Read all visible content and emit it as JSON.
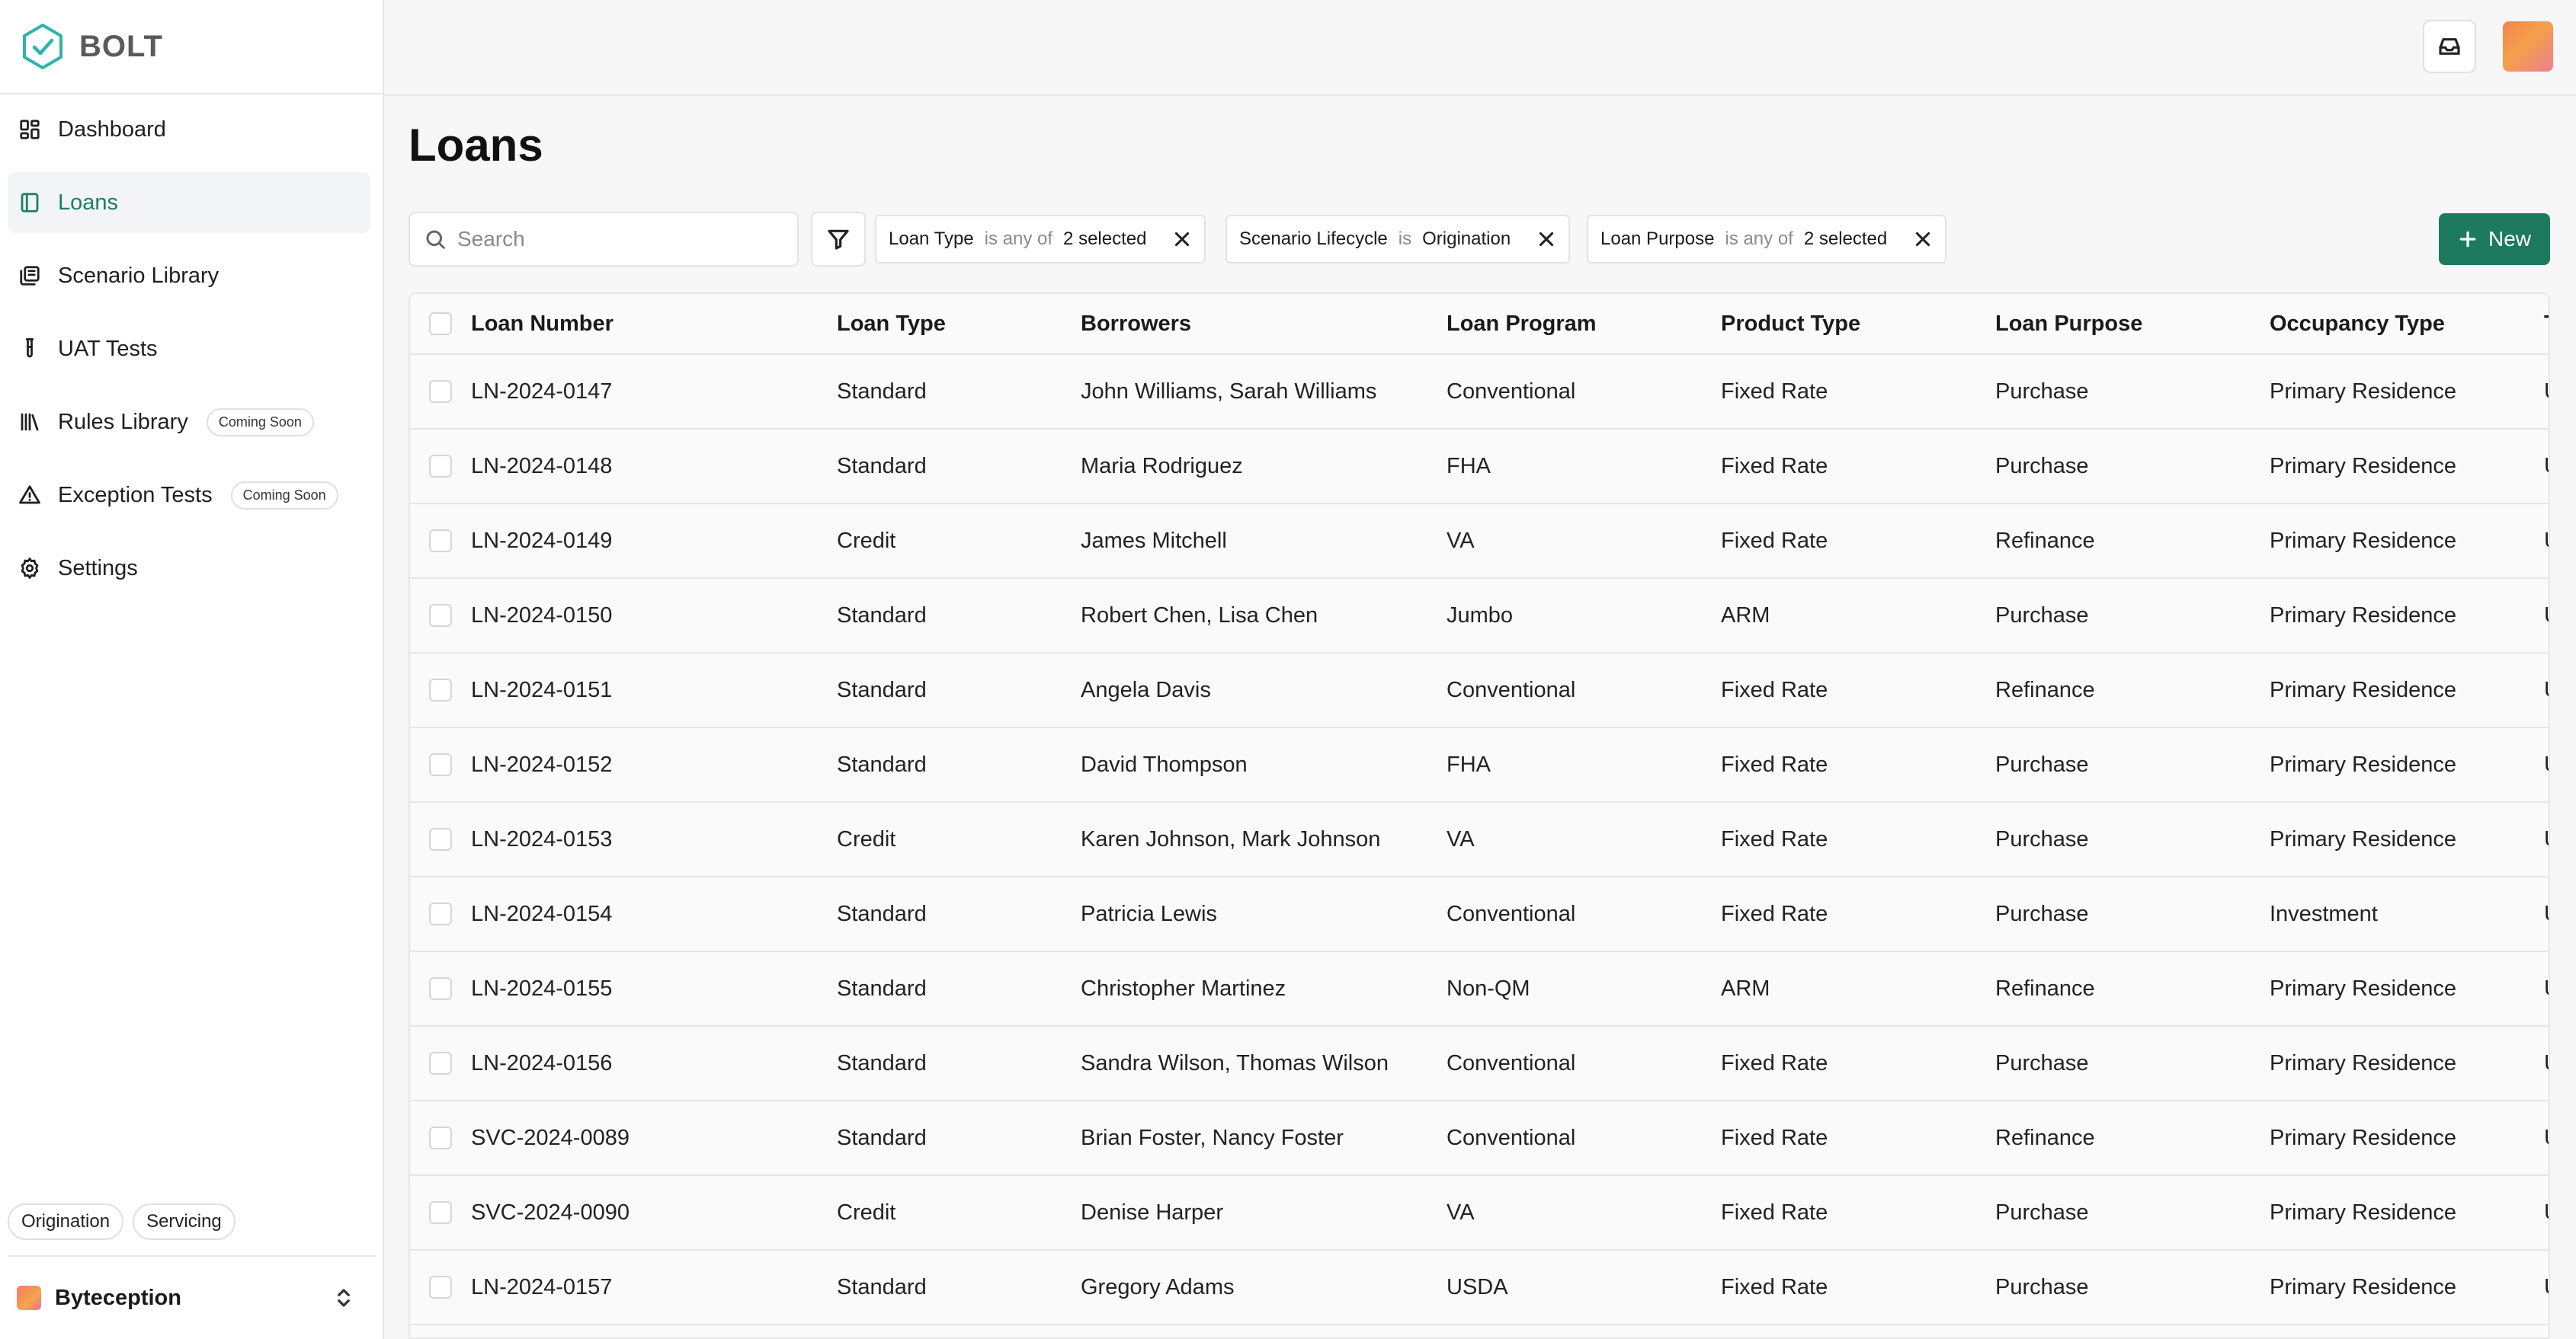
{
  "brand": {
    "name": "BOLT"
  },
  "sidebar": {
    "items": [
      {
        "label": "Dashboard",
        "icon": "dashboard-icon",
        "active": false
      },
      {
        "label": "Loans",
        "icon": "book-icon",
        "active": true
      },
      {
        "label": "Scenario Library",
        "icon": "library-icon",
        "active": false
      },
      {
        "label": "UAT Tests",
        "icon": "test-tube-icon",
        "active": false
      },
      {
        "label": "Rules Library",
        "icon": "books-icon",
        "badge": "Coming Soon",
        "active": false
      },
      {
        "label": "Exception Tests",
        "icon": "warning-icon",
        "badge": "Coming Soon",
        "active": false
      },
      {
        "label": "Settings",
        "icon": "gear-icon",
        "active": false
      }
    ],
    "modes": [
      "Origination",
      "Servicing"
    ],
    "org": {
      "name": "Byteception"
    }
  },
  "page": {
    "title": "Loans"
  },
  "toolbar": {
    "search_placeholder": "Search",
    "filters": [
      {
        "field": "Loan Type",
        "op": "is any of",
        "value": "2 selected"
      },
      {
        "field": "Scenario Lifecycle",
        "op": "is",
        "value": "Origination"
      },
      {
        "field": "Loan Purpose",
        "op": "is any of",
        "value": "2 selected"
      }
    ],
    "new_label": "New"
  },
  "table": {
    "columns": [
      "Loan Number",
      "Loan Type",
      "Borrowers",
      "Loan Program",
      "Product Type",
      "Loan Purpose",
      "Occupancy Type",
      "T"
    ],
    "rows": [
      [
        "LN-2024-0147",
        "Standard",
        "John Williams, Sarah Williams",
        "Conventional",
        "Fixed Rate",
        "Purchase",
        "Primary Residence",
        "U"
      ],
      [
        "LN-2024-0148",
        "Standard",
        "Maria Rodriguez",
        "FHA",
        "Fixed Rate",
        "Purchase",
        "Primary Residence",
        "U"
      ],
      [
        "LN-2024-0149",
        "Credit",
        "James Mitchell",
        "VA",
        "Fixed Rate",
        "Refinance",
        "Primary Residence",
        "U"
      ],
      [
        "LN-2024-0150",
        "Standard",
        "Robert Chen, Lisa Chen",
        "Jumbo",
        "ARM",
        "Purchase",
        "Primary Residence",
        "U"
      ],
      [
        "LN-2024-0151",
        "Standard",
        "Angela Davis",
        "Conventional",
        "Fixed Rate",
        "Refinance",
        "Primary Residence",
        "U"
      ],
      [
        "LN-2024-0152",
        "Standard",
        "David Thompson",
        "FHA",
        "Fixed Rate",
        "Purchase",
        "Primary Residence",
        "U"
      ],
      [
        "LN-2024-0153",
        "Credit",
        "Karen Johnson, Mark Johnson",
        "VA",
        "Fixed Rate",
        "Purchase",
        "Primary Residence",
        "U"
      ],
      [
        "LN-2024-0154",
        "Standard",
        "Patricia Lewis",
        "Conventional",
        "Fixed Rate",
        "Purchase",
        "Investment",
        "U"
      ],
      [
        "LN-2024-0155",
        "Standard",
        "Christopher Martinez",
        "Non-QM",
        "ARM",
        "Refinance",
        "Primary Residence",
        "U"
      ],
      [
        "LN-2024-0156",
        "Standard",
        "Sandra Wilson, Thomas Wilson",
        "Conventional",
        "Fixed Rate",
        "Purchase",
        "Primary Residence",
        "U"
      ],
      [
        "SVC-2024-0089",
        "Standard",
        "Brian Foster, Nancy Foster",
        "Conventional",
        "Fixed Rate",
        "Refinance",
        "Primary Residence",
        "U"
      ],
      [
        "SVC-2024-0090",
        "Credit",
        "Denise Harper",
        "VA",
        "Fixed Rate",
        "Purchase",
        "Primary Residence",
        "U"
      ],
      [
        "LN-2024-0157",
        "Standard",
        "Gregory Adams",
        "USDA",
        "Fixed Rate",
        "Purchase",
        "Primary Residence",
        "U"
      ]
    ]
  },
  "colors": {
    "accent": "#1d7a5f",
    "active_nav_text": "#1e7e64"
  }
}
